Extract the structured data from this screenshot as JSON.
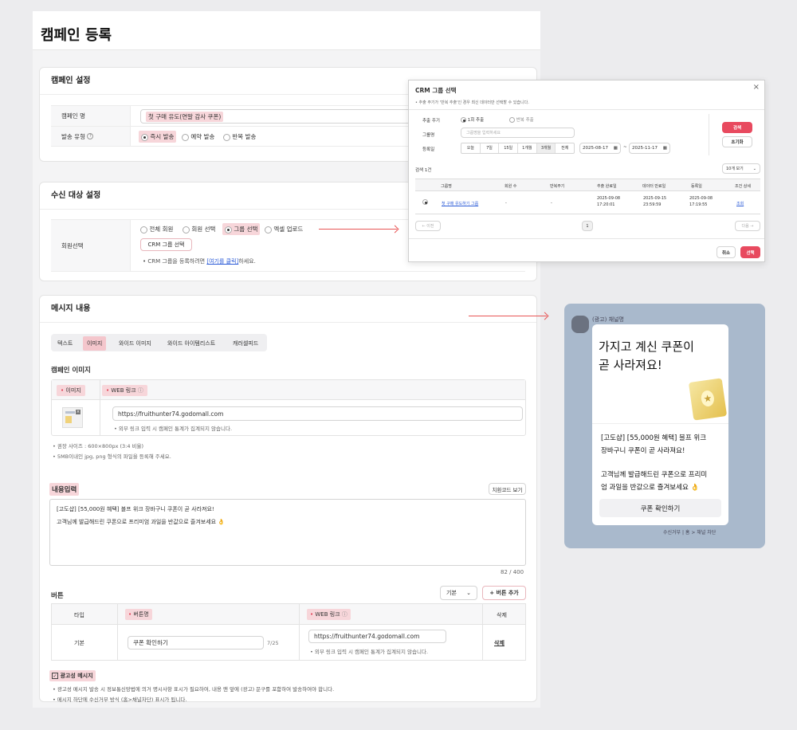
{
  "page": {
    "title": "캠페인 등록"
  },
  "campaign_settings": {
    "title": "캠페인 설정",
    "name_label": "캠페인 명",
    "name_value": "첫 구매 유도(연말 감사 쿠폰)",
    "type_label": "발송 유형",
    "type_options": [
      "즉시 발송",
      "예약 발송",
      "반복 발송"
    ]
  },
  "target": {
    "title": "수신 대상 설정",
    "member_label": "회원선택",
    "member_options": [
      "전체 회원",
      "회원 선택",
      "그룹 선택",
      "엑셀 업로드"
    ],
    "crm_button": "CRM 그룹 선택",
    "note_prefix": "CRM 그룹을 등록하려면 ",
    "note_link": "[여기를 클릭]",
    "note_suffix": "하세요."
  },
  "message": {
    "title": "메시지 내용",
    "tabs": [
      "텍스트",
      "이미지",
      "와이드 이미지",
      "와이드 아이템리스트",
      "캐러셀피드"
    ],
    "image_section": "캠페인 이미지",
    "col_image": "이미지",
    "col_weblink": "WEB 링크",
    "weblink_value": "https://fruithunter74.godomall.com",
    "weblink_note": "외부 링크 입력 시 캠페인 통계가 집계되지 않습니다.",
    "notes": [
      "권장 사이즈 : 600×800px (3:4 비율)",
      "5MB이내인 jpg, png 형식의 파일을 등록해 주세요."
    ],
    "content_label": "내용입력",
    "substitute_button": "치환코드 보기",
    "content_line1": "[고도샵] [55,000원 혜택] 블프 위크 장바구니 쿠폰이 곧 사라져요!",
    "content_line2": "고객님께 발급해드린 쿠폰으로 프리미엄 과일을 반값으로 즐겨보세요 👌",
    "char_count": "82 / 400",
    "button_section": "버튼",
    "button_type_select": "기본",
    "add_button": "버튼 추가",
    "table_headers": [
      "타입",
      "버튼명",
      "WEB 링크",
      "삭제"
    ],
    "row_type": "기본",
    "row_name": "쿠폰 확인하기",
    "row_count": "7/25",
    "row_link": "https://fruithunter74.godomall.com",
    "row_link_note": "외부 링크 입력 시 캠페인 통계가 집계되지 않습니다.",
    "row_delete": "삭제",
    "ad_checkbox": "광고성 메시지",
    "ad_notes": [
      "광고성 메시지 발송 시 정보통신망법에 의거 명시사항 표시가 필요하여, 내용 맨 앞에 (광고) 문구를 포함하여 발송하여야 합니다.",
      "메시지 하단에 수신거부 방식 (홈>채널차단) 표시가 됩니다."
    ]
  },
  "modal": {
    "title": "CRM 그룹 선택",
    "subtitle": "추출 주기가 '반복 추출'인 경우 최신 데이터만 선택할 수 있습니다.",
    "extract_label": "추출 주기",
    "extract_options": [
      "1회 추출",
      "반복 추출"
    ],
    "group_label": "그룹명",
    "group_placeholder": "그룹명을 입력하세요",
    "date_label": "등록일",
    "date_buttons": [
      "오늘",
      "7일",
      "15일",
      "1개월",
      "3개월",
      "전체"
    ],
    "date_from": "2025-08-17",
    "date_to": "2025-11-17",
    "date_sep": "~",
    "search_button": "검색",
    "reset_button": "초기화",
    "result_label": "검색 1건",
    "page_size": "10개 보기",
    "headers": [
      "그룹명",
      "회원 수",
      "반복주기",
      "추출 완료일",
      "데이터 만료일",
      "등록일",
      "조건 상세"
    ],
    "row": {
      "name": "첫 구매 유도하기 그룹",
      "count": "-",
      "cycle": "-",
      "extracted": "2025-09-08 17:20:01",
      "expires": "2025-09-15 23:59:59",
      "registered": "2025-09-08 17:19:55",
      "detail": "조회"
    },
    "prev": "← 이전",
    "page": "1",
    "next": "다음 →",
    "cancel": "취소",
    "select": "선택"
  },
  "preview": {
    "channel": "(광고) 채널명",
    "headline1": "가지고 계신 쿠폰이",
    "headline2": "곧 사라져요!",
    "body1": "[고도샵] [55,000원 혜택] 블프 위크",
    "body2": "장바구니 쿠폰이 곧 사라져요!",
    "body3": "고객님께 발급해드린 쿠폰으로 프리미",
    "body4": "엄 과일을 반값으로 즐겨보세요 👌",
    "button": "쿠폰 확인하기",
    "footer": "수신거부 | 홈 > 채널 차단"
  },
  "colors": {
    "accent": "#e84a5f",
    "highlight": "#f7d6da",
    "preview_bg": "#a9b9cc"
  }
}
